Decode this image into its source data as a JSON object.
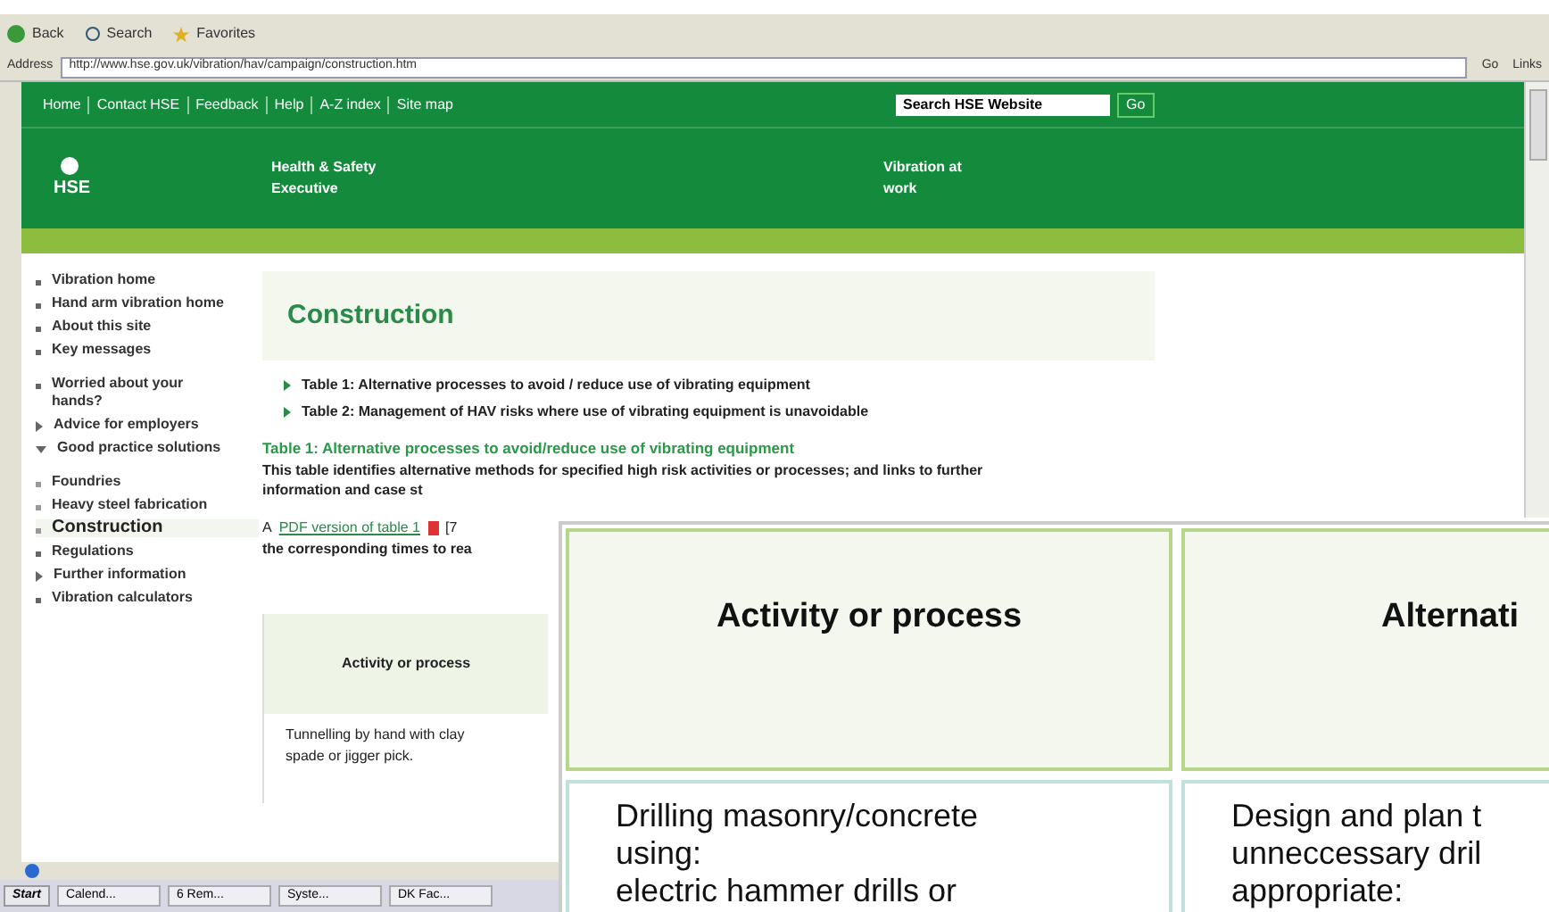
{
  "browser": {
    "toolbar": [
      {
        "label": "Back",
        "kind": "back"
      },
      {
        "label": "Search",
        "kind": "search"
      },
      {
        "label": "Favorites",
        "kind": "star"
      }
    ],
    "address_label": "Address",
    "url": "http://www.hse.gov.uk/vibration/hav/campaign/construction.htm",
    "go": "Go",
    "links": "Links"
  },
  "site": {
    "nav": [
      "Home",
      "Contact HSE",
      "Feedback",
      "Help",
      "A-Z index",
      "Site map"
    ],
    "search": {
      "value": "Search HSE Website",
      "button": "Go"
    },
    "logo": "HSE",
    "org": "Health & Safety\nExecutive",
    "section": "Vibration at\nwork"
  },
  "sidebar": [
    {
      "label": "Vibration home",
      "kind": "bullet"
    },
    {
      "label": "Hand arm vibration home",
      "kind": "bullet"
    },
    {
      "label": "About this site",
      "kind": "bullet"
    },
    {
      "label": "Key messages",
      "kind": "bullet"
    },
    {
      "label": "Worried about your hands?",
      "kind": "bullet"
    },
    {
      "label": "Advice for employers",
      "kind": "arrow",
      "expanded": false
    },
    {
      "label": "Good practice solutions",
      "kind": "arrow",
      "expanded": true,
      "children": [
        {
          "label": "Foundries",
          "selected": false
        },
        {
          "label": "Heavy steel fabrication",
          "selected": false
        },
        {
          "label": "Construction",
          "selected": true
        }
      ]
    },
    {
      "label": "Regulations",
      "kind": "bullet"
    },
    {
      "label": "Further information",
      "kind": "arrow",
      "expanded": false
    },
    {
      "label": "Vibration calculators",
      "kind": "bullet"
    }
  ],
  "main": {
    "heading": "Construction",
    "links": [
      "Table 1: Alternative processes to avoid / reduce use of vibrating equipment",
      "Table 2: Management of HAV risks where use of vibrating equipment is unavoidable"
    ],
    "subheading": "Table 1: Alternative processes to avoid/reduce use of vibrating equipment",
    "paragraph": "This table identifies alternative methods for specified high risk activities or processes; and links to further information and case st",
    "pdf_prefix": "A",
    "pdf_link": "PDF version of table 1",
    "pdf_suffix": "[7",
    "pdf_line_2": "the corresponding times to rea",
    "table": {
      "header": "Activity or process",
      "cell": "Tunnelling by hand with clay spade or jigger pick."
    }
  },
  "taskbar": {
    "start": "Start",
    "items": [
      "Calend...",
      "6 Rem...",
      "Syste...",
      "DK Fac..."
    ]
  },
  "zoomed_table": {
    "columns": [
      "Activity or process",
      "Alternati"
    ],
    "cells": [
      "Drilling masonry/concrete\nusing:\nelectric hammer drills or",
      "Design and plan t\nunneccessary dril\nappropriate:"
    ]
  }
}
